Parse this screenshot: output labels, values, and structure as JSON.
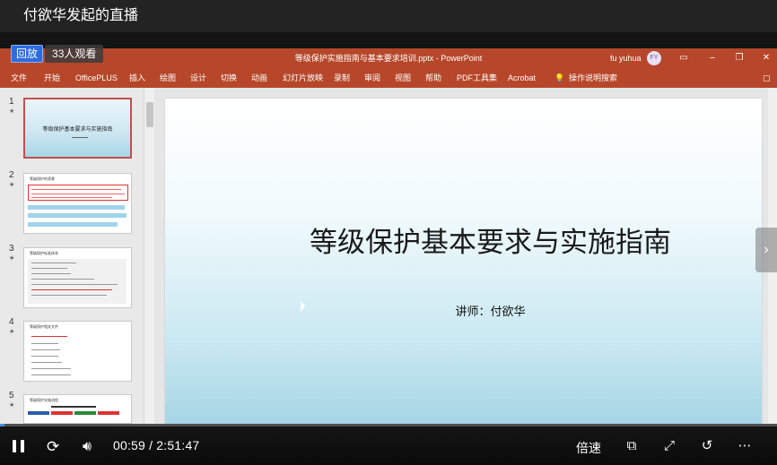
{
  "live": {
    "title": "付欲华发起的直播",
    "replay_label": "回放",
    "viewers": "33人观看"
  },
  "ppt": {
    "doc_title": "等级保护实施指南与基本要求培训.pptx - PowerPoint",
    "user_name": "fu yuhua",
    "avatar_initials": "FY",
    "ribbon_tabs": [
      "文件",
      "开始",
      "OfficePLUS",
      "插入",
      "绘图",
      "设计",
      "切换",
      "动画",
      "幻灯片放映",
      "录制",
      "审阅",
      "视图",
      "帮助",
      "PDF工具集",
      "Acrobat",
      "操作说明搜索"
    ]
  },
  "thumbnails": [
    {
      "num": "1",
      "title": "等级保护基本要求与实施指南"
    },
    {
      "num": "2",
      "title": "等级保护的背景"
    },
    {
      "num": "3",
      "title": "等级保护标准体系"
    },
    {
      "num": "4",
      "title": "等级保护相关文件"
    },
    {
      "num": "5",
      "title": "等级保护实施流程"
    }
  ],
  "slide": {
    "title": "等级保护基本要求与实施指南",
    "subtitle": "讲师：付欲华"
  },
  "player": {
    "time": "00:59 / 2:51:47",
    "progress": 0.0057,
    "speed_label": "倍速"
  },
  "colors": {
    "ppt_accent": "#b7472a",
    "replay_badge": "#2d6cdf",
    "progress": "#4a90e2"
  }
}
